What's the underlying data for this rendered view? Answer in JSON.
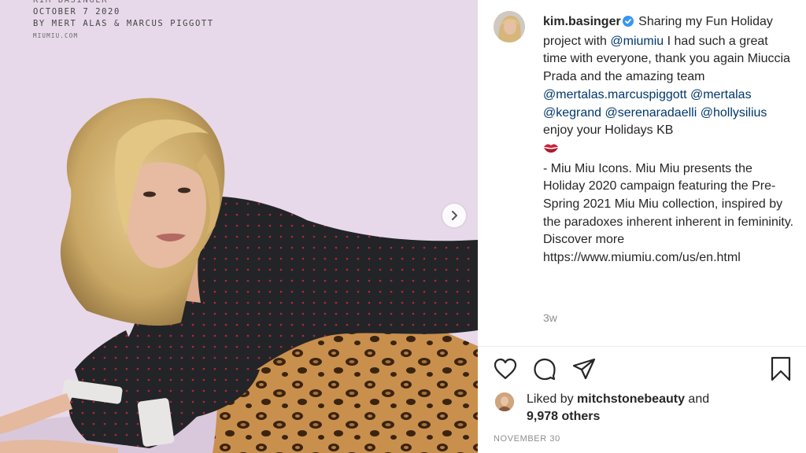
{
  "photo": {
    "credit_line_0": "KIM BASINGER",
    "credit_line_1": "OCTOBER 7 2020",
    "credit_line_2": "BY MERT ALAS & MARCUS PIGGOTT",
    "credit_line_3": "MIUMIU.COM",
    "next_icon": "chevron-right-icon"
  },
  "post": {
    "username": "kim.basinger",
    "verified_icon": "verified-badge-icon",
    "caption_parts": {
      "p1": "Sharing my Fun Holiday project with ",
      "m1": "@miumiu",
      "p2": " I had such a great time with everyone, thank you again Miuccia Prada and the amazing team ",
      "m2": "@mertalas.marcuspiggott",
      "m3": "@mertalas",
      "m4": "@kegrand",
      "m5": "@serenaradaelli",
      "m6": "@hollysilius",
      "p3": " enjoy your Holidays KB",
      "p4": "- Miu Miu Icons. Miu Miu presents the Holiday 2020 campaign featuring the Pre-Spring 2021 Miu Miu collection, inspired by the paradoxes inherent inherent in femininity. Discover more https://www.miumiu.com/us/en.html"
    },
    "time_ago": "3w"
  },
  "actions": {
    "like_icon": "heart-icon",
    "comment_icon": "comment-icon",
    "share_icon": "paper-plane-icon",
    "save_icon": "bookmark-icon"
  },
  "likes": {
    "prefix": "Liked by ",
    "user": "mitchstonebeauty",
    "and": " and",
    "others": "9,978 others"
  },
  "date": "NOVEMBER 30",
  "colors": {
    "mention": "#00376b",
    "verified": "#3897f0",
    "muted": "#8e8e8e",
    "background_photo": "#e7d9ea"
  }
}
